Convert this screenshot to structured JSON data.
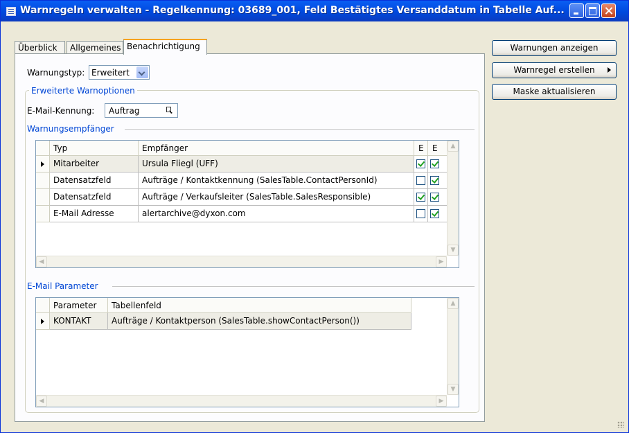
{
  "window": {
    "title": "Warnregeln verwalten - Regelkennung: 03689_001, Feld Bestätigtes Versanddatum in Tabelle Auf..."
  },
  "tabs": [
    {
      "label": "Überblick"
    },
    {
      "label": "Allgemeines"
    },
    {
      "label": "Benachrichtigung"
    }
  ],
  "form": {
    "warnungstyp_label": "Warnungstyp:",
    "warnungstyp_value": "Erweitert",
    "group_erweitert": "Erweiterte Warnoptionen",
    "email_kennung_label": "E-Mail-Kennung:",
    "email_kennung_value": "Auftrag"
  },
  "recipients": {
    "title": "Warnungsempfänger",
    "columns": [
      "Typ",
      "Empfänger",
      "E",
      "E"
    ],
    "rows": [
      {
        "typ": "Mitarbeiter",
        "empfaenger": "Ursula Fliegl (UFF)",
        "e1": true,
        "e2": true
      },
      {
        "typ": "Datensatzfeld",
        "empfaenger": "Aufträge / Kontaktkennung (SalesTable.ContactPersonId)",
        "e1": false,
        "e2": true
      },
      {
        "typ": "Datensatzfeld",
        "empfaenger": "Aufträge / Verkaufsleiter (SalesTable.SalesResponsible)",
        "e1": true,
        "e2": true
      },
      {
        "typ": "E-Mail Adresse",
        "empfaenger": "alertarchive@dyxon.com",
        "e1": false,
        "e2": true
      }
    ]
  },
  "email_params": {
    "title": "E-Mail Parameter",
    "columns": [
      "Parameter",
      "Tabellenfeld"
    ],
    "rows": [
      {
        "parameter": "KONTAKT",
        "tabellenfeld": "Aufträge / Kontaktperson (SalesTable.showContactPerson())"
      }
    ]
  },
  "buttons": {
    "warnungen_anzeigen": "Warnungen anzeigen",
    "warnregel_erstellen": "Warnregel erstellen",
    "maske_aktualisieren": "Maske aktualisieren"
  },
  "icons": [
    "app-icon",
    "minimize-icon",
    "maximize-icon",
    "close-icon",
    "dropdown-arrow-icon",
    "lookup-icon",
    "row-pointer-icon",
    "checkbox-icon",
    "submenu-arrow-icon",
    "resize-grip-icon"
  ]
}
